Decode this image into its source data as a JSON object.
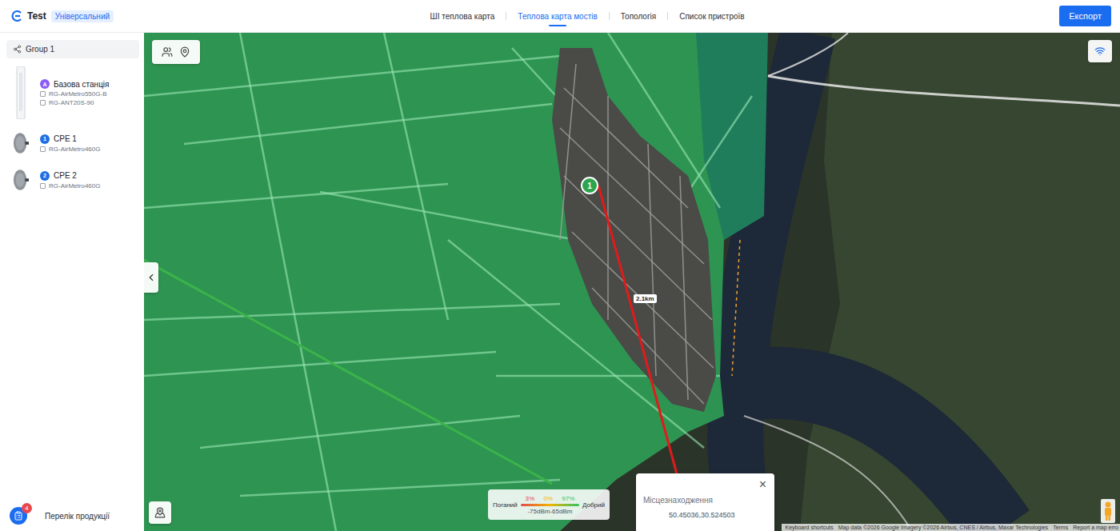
{
  "app": {
    "title": "Test",
    "badge": "Універсальний"
  },
  "tabs": [
    {
      "label": "ШІ теплова карта",
      "selected": false
    },
    {
      "label": "Теплова карта мостів",
      "selected": true
    },
    {
      "label": "Топологія",
      "selected": false
    },
    {
      "label": "Список пристроїв",
      "selected": false
    }
  ],
  "export_button": "Експорт",
  "sidebar": {
    "group": "Group 1",
    "devices": [
      {
        "kind": "base",
        "name": "Базова станція",
        "marker": "A",
        "color": "#8a5cf6",
        "models": [
          "RG-AirMetro550G-B",
          "RG-ANT20S-90"
        ]
      },
      {
        "kind": "cpe",
        "name": "CPE 1",
        "marker": "1",
        "color": "#1f6fe5",
        "models": [
          "RG-AirMetro460G"
        ]
      },
      {
        "kind": "cpe",
        "name": "CPE 2",
        "marker": "2",
        "color": "#1f6fe5",
        "models": [
          "RG-AirMetro460G"
        ]
      }
    ],
    "products": {
      "label": "Перелік продукції",
      "count": "4"
    }
  },
  "map": {
    "node": {
      "label": "1",
      "color": "#2da44e"
    },
    "link_distance": "2.1km",
    "legend": {
      "bad": "Поганий",
      "good": "Добрий",
      "range": "-75dBm-65dBm",
      "shares": [
        {
          "value": "3%",
          "color": "#e5484d"
        },
        {
          "value": "0%",
          "color": "#f0b400"
        },
        {
          "value": "97%",
          "color": "#2fc463"
        }
      ]
    },
    "popup": {
      "title": "Місцезнаходження",
      "close": "×",
      "coords": "50.45036,30.524503"
    },
    "attribution": [
      "Keyboard shortcuts",
      "Map data ©2026 Google Imagery ©2026 Airbus, CNES / Airbus, Maxar Technologies",
      "Terms",
      "Report a map erro"
    ]
  }
}
